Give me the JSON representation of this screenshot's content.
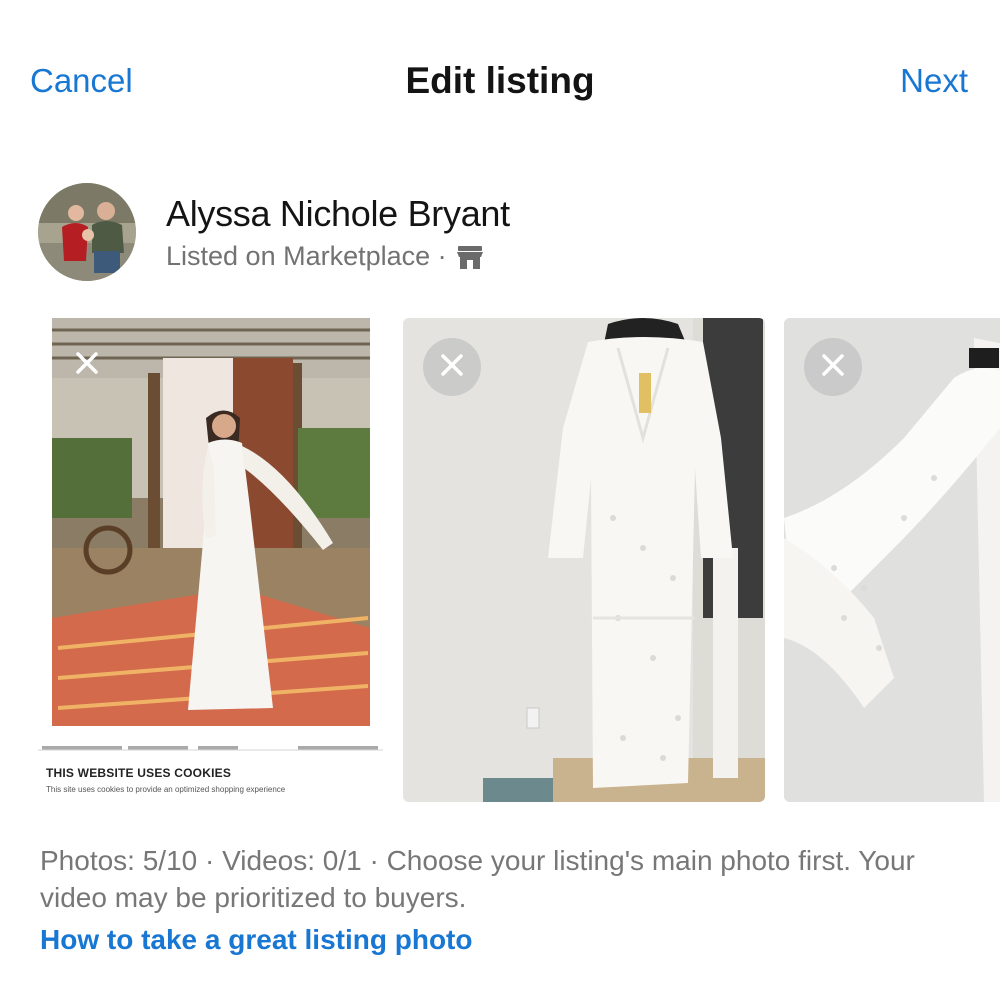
{
  "header": {
    "cancel_label": "Cancel",
    "title": "Edit listing",
    "next_label": "Next"
  },
  "seller": {
    "name": "Alyssa Nichole Bryant",
    "subline": "Listed on Marketplace ·",
    "subline_icon": "storefront-icon"
  },
  "photos": {
    "items": [
      {
        "description": "screenshot of white eyelet dress on model",
        "overlay_title": "THIS WEBSITE USES COOKIES",
        "overlay_text": "This site uses cookies to provide an optimized shopping experience"
      },
      {
        "description": "white eyelet dress on hanger"
      },
      {
        "description": "close-up of dress bell sleeve"
      }
    ],
    "remove_icon": "close-icon"
  },
  "caption": {
    "text": "Photos: 5/10 · Videos: 0/1 · Choose your listing's main photo first. Your video may be prioritized to buyers.",
    "link": "How to take a great listing photo"
  },
  "colors": {
    "accent": "#1877d2",
    "secondary_text": "#777777"
  }
}
